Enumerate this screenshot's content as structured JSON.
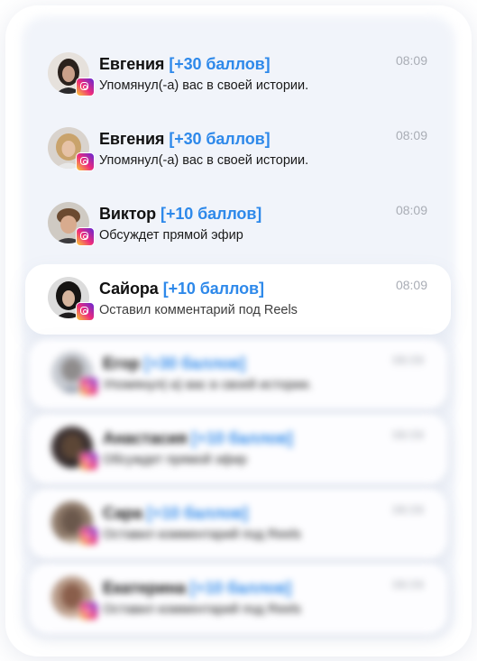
{
  "notifications": [
    {
      "name": "Евгения",
      "points": "[+30 баллов]",
      "message": "Упомянул(-а) вас в своей истории.",
      "time": "08:09",
      "blurred": false
    },
    {
      "name": "Евгения",
      "points": "[+30 баллов]",
      "message": "Упомянул(-а) вас в своей истории.",
      "time": "08:09",
      "blurred": false
    },
    {
      "name": "Виктор",
      "points": "[+10 баллов]",
      "message": "Обсуждет прямой эфир",
      "time": "08:09",
      "blurred": false
    },
    {
      "name": "Сайора",
      "points": "[+10 баллов]",
      "message": "Оставил комментарий под Reels",
      "time": "08:09",
      "blurred": false
    },
    {
      "name": "Егор",
      "points": "[+30 баллов]",
      "message": "Упомянул(-а) вас в своей истории.",
      "time": "08:09",
      "blurred": true
    },
    {
      "name": "Анастасия",
      "points": "[+10 баллов]",
      "message": "Обсуждет прямой эфир",
      "time": "08:09",
      "blurred": true
    },
    {
      "name": "Сара",
      "points": "[+10 баллов]",
      "message": "Оставил комментарий под Reels",
      "time": "08:09",
      "blurred": true
    },
    {
      "name": "Екатерина",
      "points": "[+10 баллов]",
      "message": "Оставил комментарий под Reels",
      "time": "08:09",
      "blurred": true
    }
  ],
  "badge_icon": "instagram-icon",
  "colors": {
    "points": "#2e89ea",
    "time": "#a9adb5",
    "name": "#111111"
  }
}
